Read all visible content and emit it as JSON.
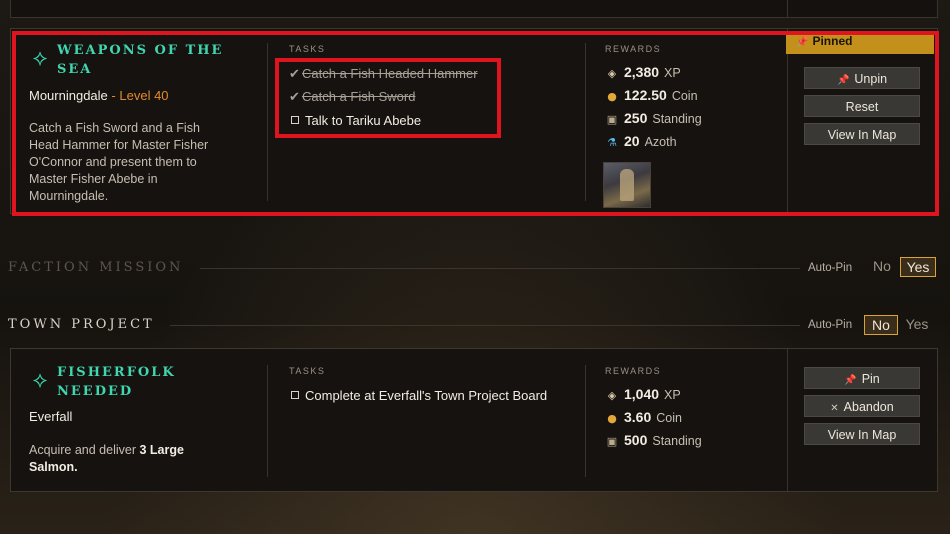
{
  "quests": [
    {
      "title": "Weapons of the Sea",
      "location": "Mourningdale",
      "separator": "-",
      "level": "Level 40",
      "description": "Catch a Fish Sword and a Fish Head Hammer for Master Fisher O'Connor and present them to Master Fisher Abebe in Mourningdale.",
      "tasks_header": "TASKS",
      "tasks": [
        {
          "label": "Catch a Fish Headed Hammer",
          "done": true
        },
        {
          "label": "Catch a Fish Sword",
          "done": true
        },
        {
          "label": "Talk to Tariku Abebe",
          "done": false
        }
      ],
      "rewards_header": "REWARDS",
      "rewards": [
        {
          "icon": "xp-icon",
          "value": "2,380",
          "unit": "XP"
        },
        {
          "icon": "coin-icon",
          "value": "122.50",
          "unit": "Coin"
        },
        {
          "icon": "standing-icon",
          "value": "250",
          "unit": "Standing"
        },
        {
          "icon": "azoth-icon",
          "value": "20",
          "unit": "Azoth"
        }
      ],
      "status": "Pinned",
      "buttons": [
        "Unpin",
        "Reset",
        "View In Map"
      ]
    },
    {
      "title": "Fisherfolk Needed",
      "location": "Everfall",
      "description_prefix": "Acquire and deliver ",
      "description_bold": "3 Large Salmon.",
      "tasks_header": "TASKS",
      "tasks": [
        {
          "label": "Complete at Everfall's Town Project Board",
          "done": false
        }
      ],
      "rewards_header": "REWARDS",
      "rewards": [
        {
          "icon": "xp-icon",
          "value": "1,040",
          "unit": "XP"
        },
        {
          "icon": "coin-icon",
          "value": "3.60",
          "unit": "Coin"
        },
        {
          "icon": "standing-icon",
          "value": "500",
          "unit": "Standing"
        }
      ],
      "buttons": [
        "Pin",
        "Abandon",
        "View In Map"
      ]
    }
  ],
  "sections": {
    "faction": {
      "title": "Faction Mission",
      "autopin_label": "Auto-Pin",
      "no": "No",
      "yes": "Yes",
      "selected": "Yes"
    },
    "town": {
      "title": "Town Project",
      "autopin_label": "Auto-Pin",
      "no": "No",
      "yes": "Yes",
      "selected": "No"
    }
  },
  "colors": {
    "quest_title": "#3fd6b0",
    "level": "#e38a2e",
    "pinned_badge": "#c3901c",
    "highlight": "#e0141e"
  }
}
